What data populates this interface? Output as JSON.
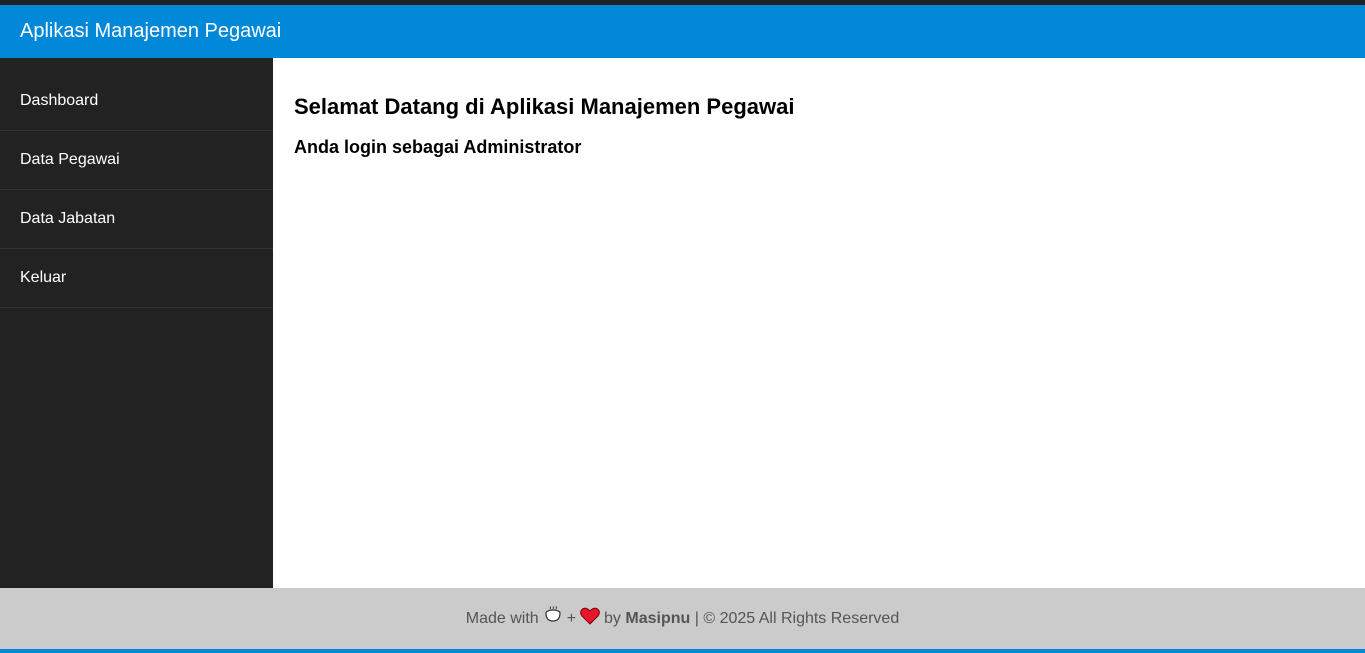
{
  "header": {
    "title": "Aplikasi Manajemen Pegawai"
  },
  "sidebar": {
    "items": [
      {
        "label": "Dashboard"
      },
      {
        "label": "Data Pegawai"
      },
      {
        "label": "Data Jabatan"
      },
      {
        "label": "Keluar"
      }
    ]
  },
  "main": {
    "heading": "Selamat Datang di Aplikasi Manajemen Pegawai",
    "subheading": "Anda login sebagai Administrator"
  },
  "footer": {
    "made_with": "Made with",
    "plus": "+",
    "by": "by",
    "author": "Masipnu",
    "rights": "| © 2025 All Rights Reserved"
  },
  "colors": {
    "header_bg": "#0288d9",
    "sidebar_bg": "#222222",
    "footer_bg": "#cbcbcb"
  }
}
